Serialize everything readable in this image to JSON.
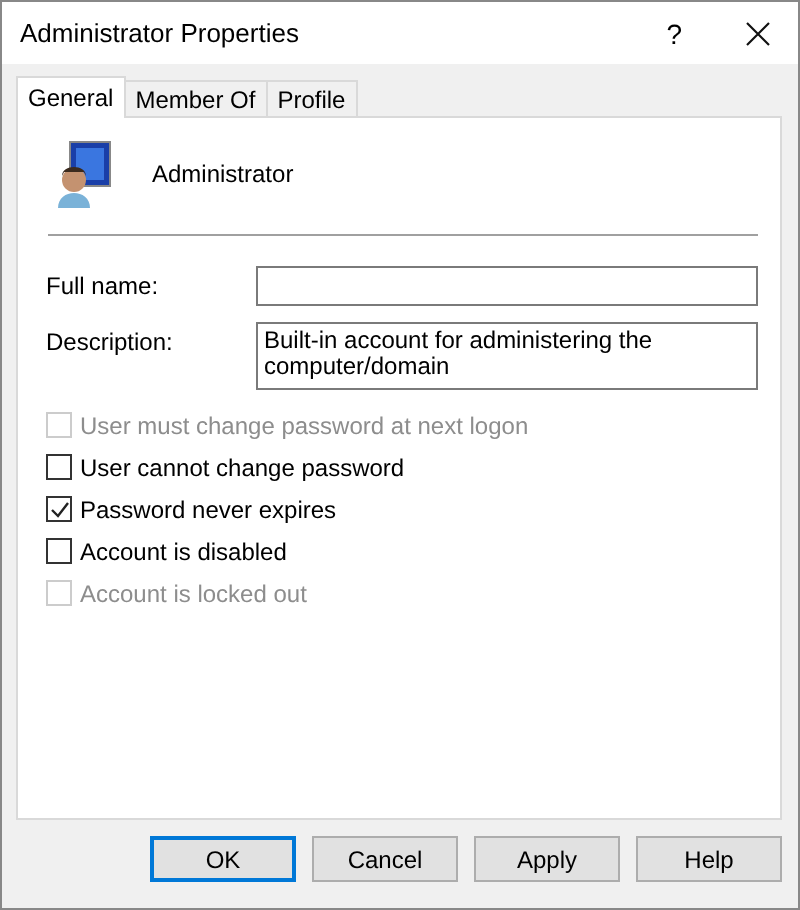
{
  "window": {
    "title": "Administrator Properties",
    "help": "?"
  },
  "tabs": [
    {
      "label": "General",
      "selected": true
    },
    {
      "label": "Member Of",
      "selected": false
    },
    {
      "label": "Profile",
      "selected": false
    }
  ],
  "user": {
    "name": "Administrator"
  },
  "fields": [
    {
      "label": "Full name:"
    },
    {
      "label": "Description:",
      "value": "Built-in account for administering the computer/domain"
    }
  ],
  "options": [
    {
      "label": "User must change password at next logon",
      "checked": false,
      "disabled": true
    },
    {
      "label": "User cannot change password",
      "checked": false,
      "disabled": false
    },
    {
      "label": "Password never expires",
      "checked": true,
      "disabled": false
    },
    {
      "label": "Account is disabled",
      "checked": false,
      "disabled": false
    },
    {
      "label": "Account is locked out",
      "checked": false,
      "disabled": true
    }
  ],
  "buttons": [
    {
      "label": "OK",
      "default": true
    },
    {
      "label": "Cancel",
      "default": false
    },
    {
      "label": "Apply",
      "default": false
    },
    {
      "label": "Help",
      "default": false
    }
  ]
}
